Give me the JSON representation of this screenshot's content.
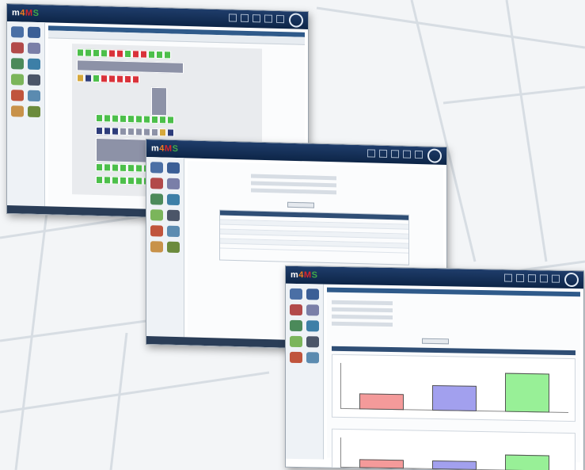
{
  "app": {
    "logo": {
      "prefix": "m",
      "middle": "4",
      "m": "M",
      "s": "S"
    }
  },
  "windows": [
    {
      "name": "warehouse-map-window",
      "view": "storage-grid"
    },
    {
      "name": "report-form-window",
      "view": "form-and-table"
    },
    {
      "name": "statistics-window",
      "view": "bar-charts"
    }
  ],
  "icons": {
    "sidebar": [
      "warehouse-icon",
      "monitor-icon",
      "box-icon",
      "document-icon",
      "tools-icon",
      "screen-icon",
      "forklift-icon",
      "chart-icon",
      "gear-icon",
      "list-icon",
      "user-icon",
      "truck-icon"
    ],
    "titlebar": [
      "bed-icon",
      "bottle-icon",
      "glass-icon",
      "cup-icon",
      "box-icon"
    ],
    "emblem": "company-emblem-icon"
  },
  "colors": {
    "titlebar": "#0d2547",
    "cell_free": "#4cbf4a",
    "cell_occupied": "#d9323a",
    "cell_reserved": "#d6a83c",
    "bar_1": "#f49a9a",
    "bar_2": "#a2a0ee",
    "bar_3": "#98f097"
  },
  "chart_data": [
    {
      "type": "bar",
      "categories": [
        "",
        "",
        ""
      ],
      "values": [
        40,
        65,
        100
      ],
      "title": "",
      "xlabel": "",
      "ylabel": "",
      "ylim": [
        0,
        110
      ]
    },
    {
      "type": "bar",
      "categories": [
        "",
        "",
        ""
      ],
      "values": [
        35,
        35,
        65
      ],
      "title": "",
      "xlabel": "",
      "ylabel": "",
      "ylim": [
        0,
        110
      ]
    }
  ]
}
